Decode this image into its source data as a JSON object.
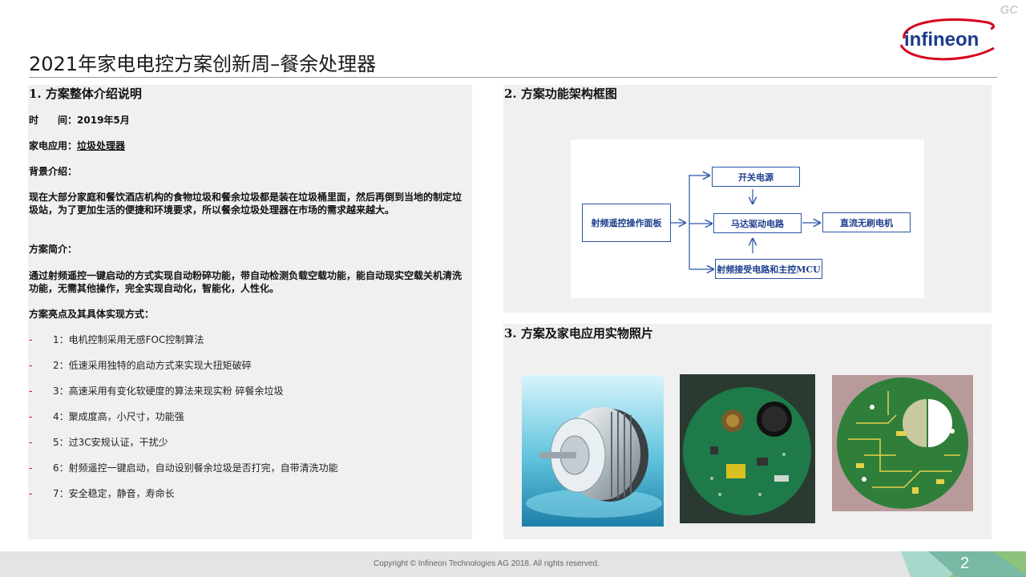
{
  "watermark": "GC",
  "logo": {
    "text": "infineon",
    "color_text": "#1b3a8c",
    "color_swoosh": "#d6001c"
  },
  "title": "2021年家电电控方案创新周–餐余处理器",
  "section1": {
    "heading": "1. 方案整体介绍说明",
    "time_label": "时　　间：",
    "time_value": "2019年5月",
    "appliance_label": "家电应用：",
    "appliance_value": "垃圾处理器",
    "bg_label": "背景介绍：",
    "bg_text": "现在大部分家庭和餐饮酒店机构的食物垃圾和餐余垃圾都是装在垃圾桶里面，然后再倒到当地的制定垃圾站，为了更加生活的便捷和环境要求，所以餐余垃圾处理器在市场的需求越来越大。",
    "intro_label": "方案简介：",
    "intro_text": "通过射频遥控一键启动的方式实现自动粉碎功能，带自动检测负载空载功能，能自动现实空载关机清洗功能，无需其他操作，完全实现自动化，智能化，人性化。",
    "highlights_label": "方案亮点及其具体实现方式：",
    "bullet_dash": "-",
    "bullets": [
      "1：电机控制采用无感FOC控制算法",
      "2：低速采用独特的启动方式来实现大扭矩破碎",
      "3：高速采用有变化软硬度的算法来现实粉 碎餐余垃圾",
      "4：聚成度高，小尺寸，功能强",
      "5：过3C安规认证，干扰少",
      "6：射频遥控一键启动，自动设别餐余垃圾是否打完，自带清洗功能",
      "7：安全稳定，静音，寿命长"
    ]
  },
  "section2": {
    "heading": "2. 方案功能架构框图",
    "boxes": {
      "rf_panel": "射频遥控操作面板",
      "power": "开关电源",
      "motor_drive": "马达驱动电路",
      "bldc": "直流无刷电机",
      "rf_mcu": "射频接受电路和主控MCU"
    },
    "colors": {
      "box_border": "#2b55a8",
      "arrow": "#2b55a8"
    }
  },
  "section3": {
    "heading": "3. 方案及家电应用实物照片"
  },
  "footer": {
    "copyright": "Copyright © Infineon Technologies AG 2018. All rights reserved.",
    "page": "2"
  }
}
